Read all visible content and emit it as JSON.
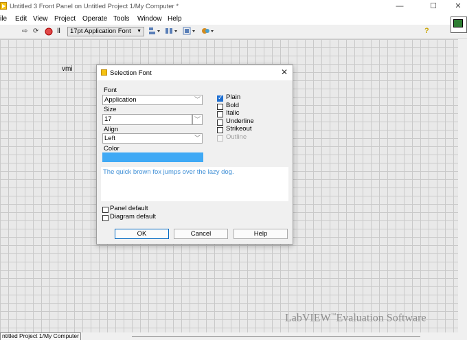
{
  "window": {
    "title": "Untitled 3 Front Panel on Untitled Project 1/My Computer *",
    "minimize_glyph": "—",
    "maximize_glyph": "☐",
    "close_glyph": "✕"
  },
  "menu": [
    "ile",
    "Edit",
    "View",
    "Project",
    "Operate",
    "Tools",
    "Window",
    "Help"
  ],
  "toolbar": {
    "font_select": "17pt Application Font",
    "font_select_arrow": "▼"
  },
  "front_panel": {
    "vi_label": "vmi"
  },
  "watermark": {
    "brand": "LabVIEW",
    "tm": "™",
    "rest": "Evaluation Software"
  },
  "status_bar": {
    "path": "ntitled Project 1/My Computer"
  },
  "dialog": {
    "title": "Selection Font",
    "close_glyph": "✕",
    "font_label": "Font",
    "font_value": "Application",
    "size_label": "Size",
    "size_value": "17",
    "align_label": "Align",
    "align_value": "Left",
    "color_label": "Color",
    "color_value": "#3fa9f5",
    "styles": [
      {
        "label": "Plain",
        "checked": true,
        "enabled": true
      },
      {
        "label": "Bold",
        "checked": false,
        "enabled": true
      },
      {
        "label": "Italic",
        "checked": false,
        "enabled": true
      },
      {
        "label": "Underline",
        "checked": false,
        "enabled": true
      },
      {
        "label": "Strikeout",
        "checked": false,
        "enabled": true
      },
      {
        "label": "Outline",
        "checked": false,
        "enabled": false
      }
    ],
    "preview_text": "The quick brown fox jumps over the lazy dog.",
    "panel_default_label": "Panel default",
    "panel_default_checked": false,
    "diagram_default_label": "Diagram default",
    "diagram_default_checked": false,
    "ok_label": "OK",
    "cancel_label": "Cancel",
    "help_label": "Help"
  },
  "colors": {
    "accent": "#0067c0",
    "preview_text": "#3f8fd6",
    "labview_yellow": "#f5c211"
  }
}
